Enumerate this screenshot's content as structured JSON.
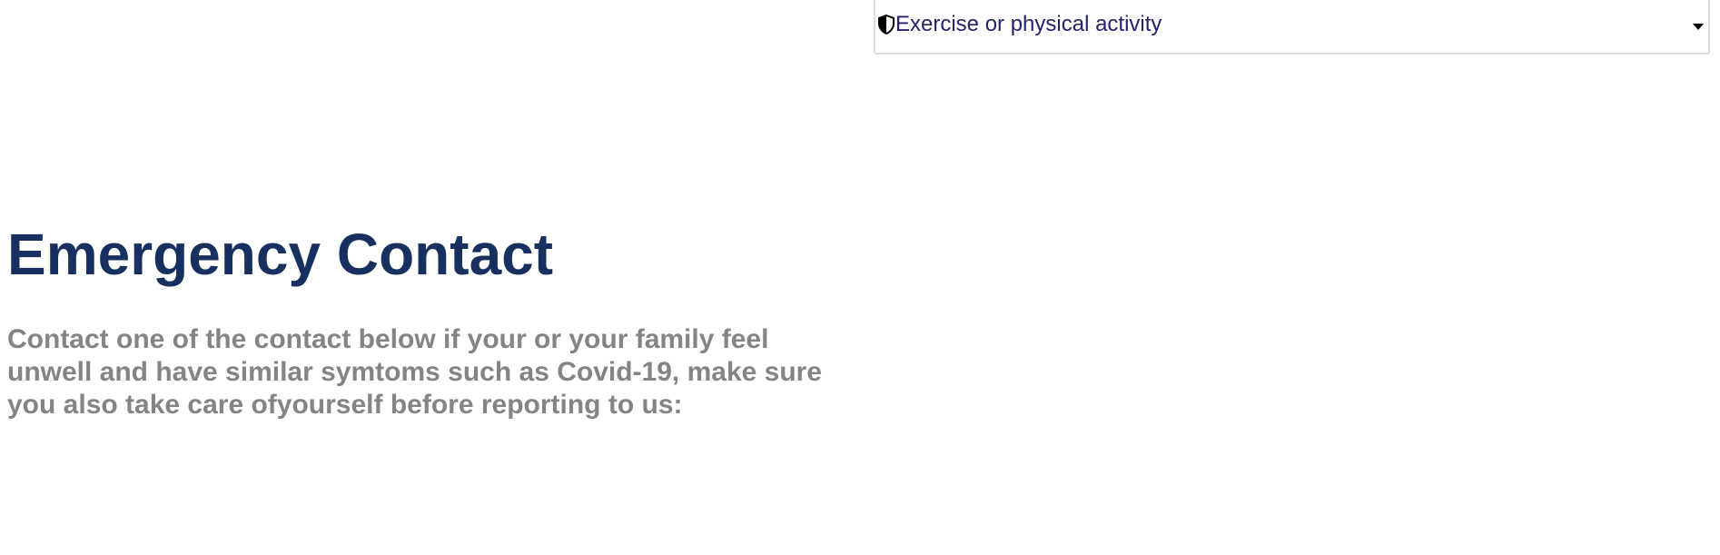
{
  "accordion": {
    "label": "Exercise or physical activity",
    "icon": "shield-half-icon",
    "toggle_icon": "caret-down-icon",
    "label_color": "#23246b"
  },
  "emergency": {
    "title": "Emergency Contact",
    "description": "Contact one of the contact below if your or your family feel unwell and have similar symtoms such as Covid-19, make sure you also take care ofyourself before reporting to us:",
    "title_color": "#17305f",
    "description_color": "#848484"
  }
}
